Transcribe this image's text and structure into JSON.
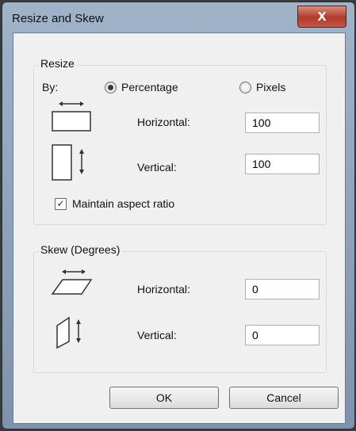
{
  "window": {
    "title": "Resize and Skew",
    "close_glyph": "x"
  },
  "resize": {
    "group_label": "Resize",
    "by_label": "By:",
    "options": [
      {
        "label": "Percentage",
        "selected": true
      },
      {
        "label": "Pixels",
        "selected": false
      }
    ],
    "horizontal_label": "Horizontal:",
    "horizontal_value": "100",
    "vertical_label": "Vertical:",
    "vertical_value": "100",
    "maintain_aspect_label": "Maintain aspect ratio",
    "maintain_aspect_checked": true
  },
  "skew": {
    "group_label": "Skew (Degrees)",
    "horizontal_label": "Horizontal:",
    "horizontal_value": "0",
    "vertical_label": "Vertical:",
    "vertical_value": "0"
  },
  "buttons": {
    "ok": "OK",
    "cancel": "Cancel"
  }
}
